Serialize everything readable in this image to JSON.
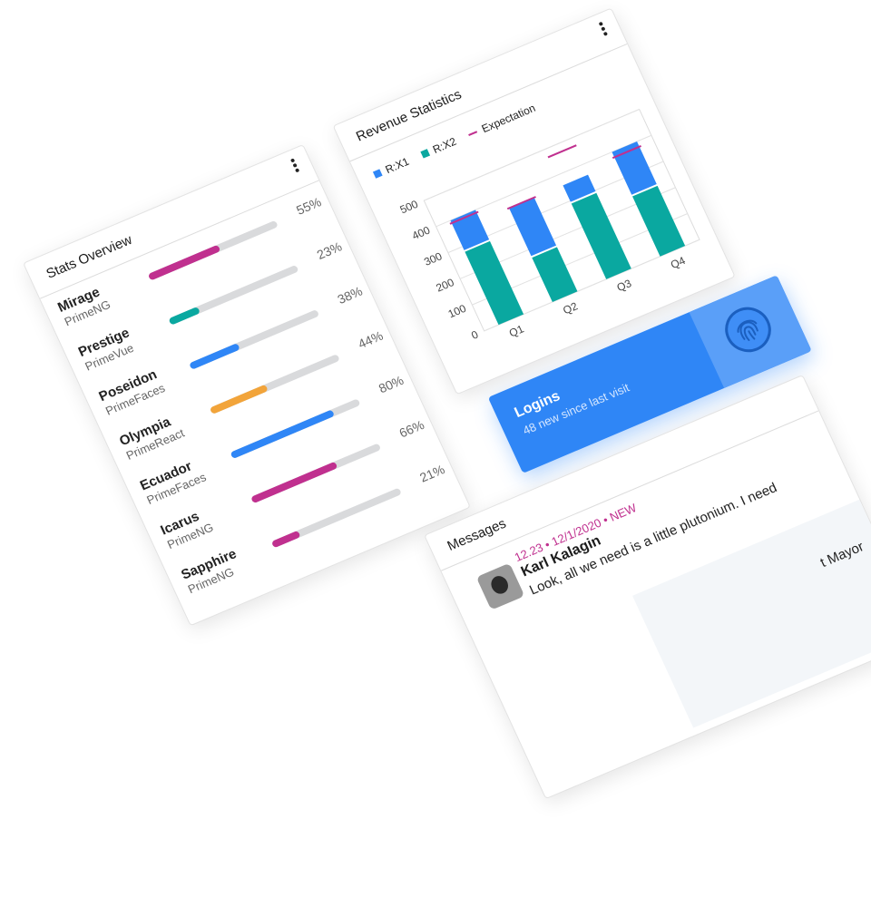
{
  "stats": {
    "title": "Stats Overview",
    "rows": [
      {
        "name": "Mirage",
        "sub": "PrimeNG",
        "value": 55,
        "label": "55%",
        "color": "#c0308f"
      },
      {
        "name": "Prestige",
        "sub": "PrimeVue",
        "value": 23,
        "label": "23%",
        "color": "#0aa8a0"
      },
      {
        "name": "Poseidon",
        "sub": "PrimeFaces",
        "value": 38,
        "label": "38%",
        "color": "#2f86f6"
      },
      {
        "name": "Olympia",
        "sub": "PrimeReact",
        "value": 44,
        "label": "44%",
        "color": "#f2a43a"
      },
      {
        "name": "Ecuador",
        "sub": "PrimeFaces",
        "value": 80,
        "label": "80%",
        "color": "#2f86f6"
      },
      {
        "name": "Icarus",
        "sub": "PrimeNG",
        "value": 66,
        "label": "66%",
        "color": "#c0308f"
      },
      {
        "name": "Sapphire",
        "sub": "PrimeNG",
        "value": 21,
        "label": "21%",
        "color": "#c0308f"
      }
    ]
  },
  "revenue": {
    "title": "Revenue Statistics",
    "legend": [
      {
        "label": "R:X1",
        "color": "#2f86f6",
        "kind": "square"
      },
      {
        "label": "R:X2",
        "color": "#0aa8a0",
        "kind": "square"
      },
      {
        "label": "Expectation",
        "color": "#c0308f",
        "kind": "line"
      }
    ]
  },
  "chart_data": {
    "type": "bar",
    "stacked": true,
    "categories": [
      "Q1",
      "Q2",
      "Q3",
      "Q4"
    ],
    "series": [
      {
        "name": "R:X2",
        "values": [
          280,
          170,
          290,
          230
        ],
        "color": "#0aa8a0"
      },
      {
        "name": "R:X1",
        "values": [
          120,
          190,
          70,
          170
        ],
        "color": "#2f86f6"
      }
    ],
    "expectation": {
      "name": "Expectation",
      "values": [
        390,
        360,
        470,
        380
      ],
      "color": "#c0308f"
    },
    "yticks": [
      0,
      100,
      200,
      300,
      400,
      500
    ],
    "ylim": [
      0,
      500
    ],
    "grid": true,
    "legend": "top-left"
  },
  "logins": {
    "title": "Logins",
    "subtitle": "48 new since last visit",
    "icon": "fingerprint-icon"
  },
  "messages": {
    "title": "Messages",
    "item": {
      "time": "12.23",
      "date": "12/1/2020",
      "badge": "NEW",
      "separator": "•",
      "author": "Karl Kalagin",
      "text": "Look, all we need is a little plutonium. I need"
    },
    "second_text": "t Mayor"
  }
}
